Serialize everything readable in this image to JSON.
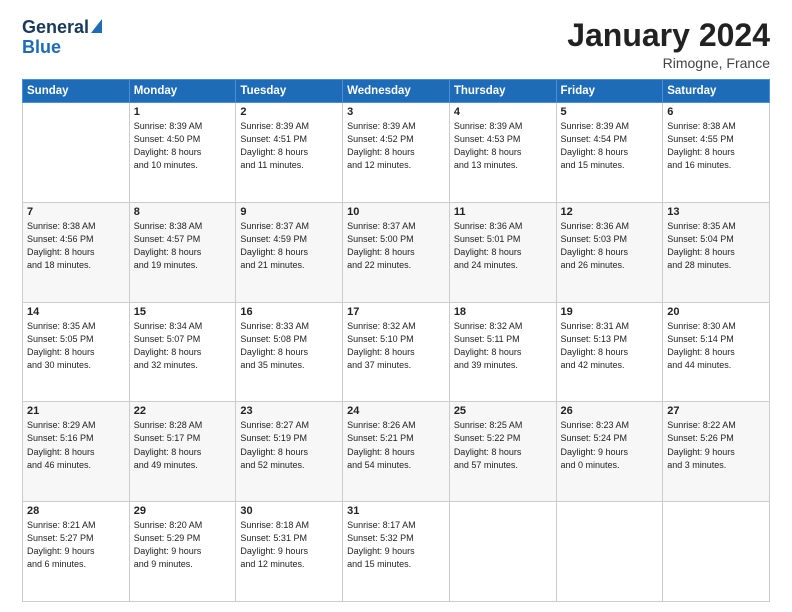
{
  "header": {
    "logo_line1": "General",
    "logo_line2": "Blue",
    "month": "January 2024",
    "location": "Rimogne, France"
  },
  "days_of_week": [
    "Sunday",
    "Monday",
    "Tuesday",
    "Wednesday",
    "Thursday",
    "Friday",
    "Saturday"
  ],
  "weeks": [
    [
      {
        "num": "",
        "detail": ""
      },
      {
        "num": "1",
        "detail": "Sunrise: 8:39 AM\nSunset: 4:50 PM\nDaylight: 8 hours\nand 10 minutes."
      },
      {
        "num": "2",
        "detail": "Sunrise: 8:39 AM\nSunset: 4:51 PM\nDaylight: 8 hours\nand 11 minutes."
      },
      {
        "num": "3",
        "detail": "Sunrise: 8:39 AM\nSunset: 4:52 PM\nDaylight: 8 hours\nand 12 minutes."
      },
      {
        "num": "4",
        "detail": "Sunrise: 8:39 AM\nSunset: 4:53 PM\nDaylight: 8 hours\nand 13 minutes."
      },
      {
        "num": "5",
        "detail": "Sunrise: 8:39 AM\nSunset: 4:54 PM\nDaylight: 8 hours\nand 15 minutes."
      },
      {
        "num": "6",
        "detail": "Sunrise: 8:38 AM\nSunset: 4:55 PM\nDaylight: 8 hours\nand 16 minutes."
      }
    ],
    [
      {
        "num": "7",
        "detail": "Sunrise: 8:38 AM\nSunset: 4:56 PM\nDaylight: 8 hours\nand 18 minutes."
      },
      {
        "num": "8",
        "detail": "Sunrise: 8:38 AM\nSunset: 4:57 PM\nDaylight: 8 hours\nand 19 minutes."
      },
      {
        "num": "9",
        "detail": "Sunrise: 8:37 AM\nSunset: 4:59 PM\nDaylight: 8 hours\nand 21 minutes."
      },
      {
        "num": "10",
        "detail": "Sunrise: 8:37 AM\nSunset: 5:00 PM\nDaylight: 8 hours\nand 22 minutes."
      },
      {
        "num": "11",
        "detail": "Sunrise: 8:36 AM\nSunset: 5:01 PM\nDaylight: 8 hours\nand 24 minutes."
      },
      {
        "num": "12",
        "detail": "Sunrise: 8:36 AM\nSunset: 5:03 PM\nDaylight: 8 hours\nand 26 minutes."
      },
      {
        "num": "13",
        "detail": "Sunrise: 8:35 AM\nSunset: 5:04 PM\nDaylight: 8 hours\nand 28 minutes."
      }
    ],
    [
      {
        "num": "14",
        "detail": "Sunrise: 8:35 AM\nSunset: 5:05 PM\nDaylight: 8 hours\nand 30 minutes."
      },
      {
        "num": "15",
        "detail": "Sunrise: 8:34 AM\nSunset: 5:07 PM\nDaylight: 8 hours\nand 32 minutes."
      },
      {
        "num": "16",
        "detail": "Sunrise: 8:33 AM\nSunset: 5:08 PM\nDaylight: 8 hours\nand 35 minutes."
      },
      {
        "num": "17",
        "detail": "Sunrise: 8:32 AM\nSunset: 5:10 PM\nDaylight: 8 hours\nand 37 minutes."
      },
      {
        "num": "18",
        "detail": "Sunrise: 8:32 AM\nSunset: 5:11 PM\nDaylight: 8 hours\nand 39 minutes."
      },
      {
        "num": "19",
        "detail": "Sunrise: 8:31 AM\nSunset: 5:13 PM\nDaylight: 8 hours\nand 42 minutes."
      },
      {
        "num": "20",
        "detail": "Sunrise: 8:30 AM\nSunset: 5:14 PM\nDaylight: 8 hours\nand 44 minutes."
      }
    ],
    [
      {
        "num": "21",
        "detail": "Sunrise: 8:29 AM\nSunset: 5:16 PM\nDaylight: 8 hours\nand 46 minutes."
      },
      {
        "num": "22",
        "detail": "Sunrise: 8:28 AM\nSunset: 5:17 PM\nDaylight: 8 hours\nand 49 minutes."
      },
      {
        "num": "23",
        "detail": "Sunrise: 8:27 AM\nSunset: 5:19 PM\nDaylight: 8 hours\nand 52 minutes."
      },
      {
        "num": "24",
        "detail": "Sunrise: 8:26 AM\nSunset: 5:21 PM\nDaylight: 8 hours\nand 54 minutes."
      },
      {
        "num": "25",
        "detail": "Sunrise: 8:25 AM\nSunset: 5:22 PM\nDaylight: 8 hours\nand 57 minutes."
      },
      {
        "num": "26",
        "detail": "Sunrise: 8:23 AM\nSunset: 5:24 PM\nDaylight: 9 hours\nand 0 minutes."
      },
      {
        "num": "27",
        "detail": "Sunrise: 8:22 AM\nSunset: 5:26 PM\nDaylight: 9 hours\nand 3 minutes."
      }
    ],
    [
      {
        "num": "28",
        "detail": "Sunrise: 8:21 AM\nSunset: 5:27 PM\nDaylight: 9 hours\nand 6 minutes."
      },
      {
        "num": "29",
        "detail": "Sunrise: 8:20 AM\nSunset: 5:29 PM\nDaylight: 9 hours\nand 9 minutes."
      },
      {
        "num": "30",
        "detail": "Sunrise: 8:18 AM\nSunset: 5:31 PM\nDaylight: 9 hours\nand 12 minutes."
      },
      {
        "num": "31",
        "detail": "Sunrise: 8:17 AM\nSunset: 5:32 PM\nDaylight: 9 hours\nand 15 minutes."
      },
      {
        "num": "",
        "detail": ""
      },
      {
        "num": "",
        "detail": ""
      },
      {
        "num": "",
        "detail": ""
      }
    ]
  ]
}
